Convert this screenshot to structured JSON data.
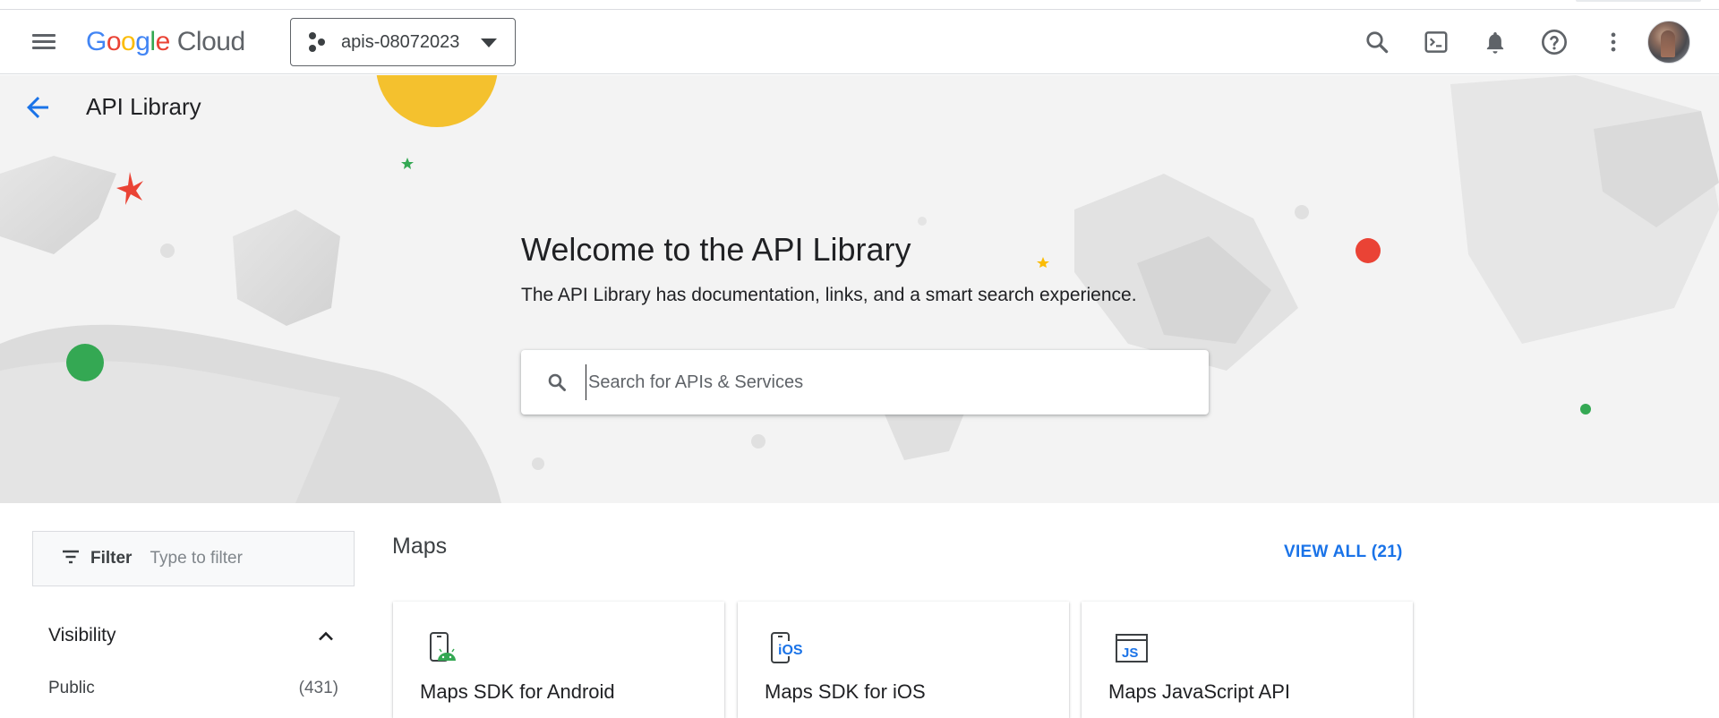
{
  "header": {
    "logo_google": "Google",
    "logo_cloud": "Cloud",
    "project_name": "apis-08072023",
    "icons": [
      "menu-icon",
      "search-icon",
      "terminal-icon",
      "bell-icon",
      "help-icon",
      "more-vert-icon"
    ]
  },
  "page": {
    "title": "API Library"
  },
  "hero": {
    "title": "Welcome to the API Library",
    "subtitle": "The API Library has documentation, links, and a smart search experience.",
    "search_placeholder": "Search for APIs & Services"
  },
  "filter": {
    "label": "Filter",
    "placeholder": "Type to filter",
    "visibility_label": "Visibility",
    "rows": [
      {
        "label": "Public",
        "count": "(431)"
      }
    ]
  },
  "section": {
    "title": "Maps",
    "view_all": "VIEW ALL (21)",
    "cards": [
      {
        "title": "Maps SDK for Android",
        "icon": "android-phone-icon"
      },
      {
        "title": "Maps SDK for iOS",
        "icon": "ios-phone-icon"
      },
      {
        "title": "Maps JavaScript API",
        "icon": "js-icon"
      }
    ]
  },
  "colors": {
    "accent": "#1a73e8",
    "google_blue": "#4285F4",
    "google_red": "#EA4335",
    "google_yellow": "#FBBC05",
    "google_green": "#34A853",
    "hero_bg": "#f3f3f3"
  }
}
